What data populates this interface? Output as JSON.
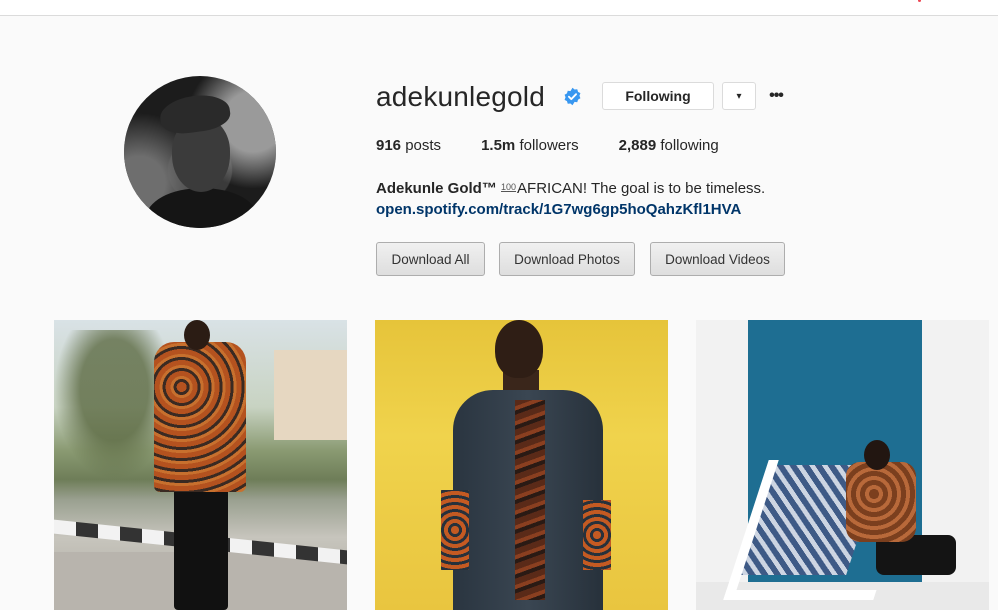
{
  "profile": {
    "username": "adekunlegold",
    "verified_icon": "verified-badge-icon",
    "follow_button": "Following",
    "dropdown_icon": "▾",
    "more_icon": "•••",
    "stats": {
      "posts_count": "916",
      "posts_label": "posts",
      "followers_count": "1.5m",
      "followers_label": "followers",
      "following_count": "2,889",
      "following_label": "following"
    },
    "full_name": "Adekunle Gold™",
    "hundred_emoji": "100",
    "bio_text": "AFRICAN! The goal is to be timeless.",
    "link": "open.spotify.com/track/1G7wg6gp5hoQahzKfl1HVA"
  },
  "download_buttons": {
    "all": "Download All",
    "photos": "Download Photos",
    "videos": "Download Videos"
  },
  "colors": {
    "verified_blue": "#3897f0",
    "link_color": "#003569",
    "notification_red": "#ed4956"
  }
}
